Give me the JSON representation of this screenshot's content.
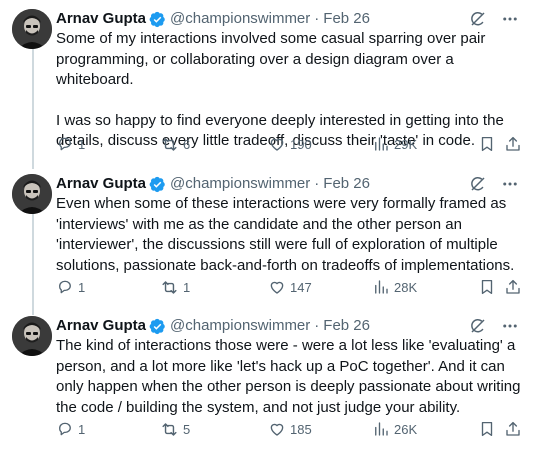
{
  "author": {
    "name": "Arnav Gupta",
    "handle": "@championswimmer",
    "separator": "·"
  },
  "colors": {
    "verified": "#1d9bf0",
    "secondary_text": "#536471",
    "thread_line": "#cfd9de"
  },
  "icons": {
    "verified": "verified-badge-icon",
    "grok": "grok-icon",
    "more": "more-dots-icon",
    "reply": "reply-bubble-icon",
    "repost": "repost-arrows-icon",
    "like": "heart-icon",
    "views": "views-bars-icon",
    "bookmark": "bookmark-icon",
    "share": "share-upload-icon"
  },
  "tweets": [
    {
      "date": "Feb 26",
      "paragraphs": [
        "Some of my interactions involved some casual sparring over pair programming, or collaborating over a design diagram over a whiteboard.",
        "I was so happy to find everyone deeply interested in getting into the details, discuss every little tradeoff, discuss their 'taste' in code."
      ],
      "replies": "1",
      "reposts": "6",
      "likes": "190",
      "views": "29K"
    },
    {
      "date": "Feb 26",
      "paragraphs": [
        "Even when some of these interactions were very formally framed as 'interviews' with me as the candidate and the other person an 'interviewer', the discussions still were full of exploration of multiple solutions, passionate back-and-forth on tradeoffs of implementations."
      ],
      "replies": "1",
      "reposts": "1",
      "likes": "147",
      "views": "28K"
    },
    {
      "date": "Feb 26",
      "paragraphs": [
        "The kind of interactions those were - were a lot less like 'evaluating' a person, and a lot more like 'let's hack up a PoC together'. And it can only happen when the other person is deeply passionate about writing the code / building the system, and not just judge your ability."
      ],
      "replies": "1",
      "reposts": "5",
      "likes": "185",
      "views": "26K"
    }
  ]
}
